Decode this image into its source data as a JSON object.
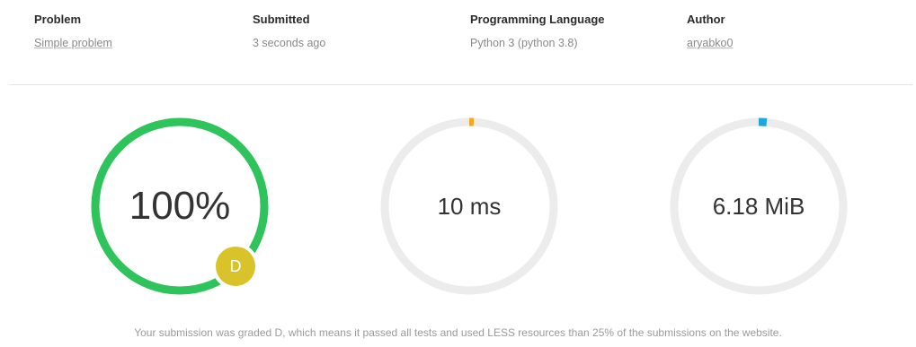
{
  "info": {
    "problem": {
      "label": "Problem",
      "value": "Simple problem"
    },
    "submitted": {
      "label": "Submitted",
      "value": "3 seconds ago"
    },
    "language": {
      "label": "Programming Language",
      "value": "Python 3 (python 3.8)"
    },
    "author": {
      "label": "Author",
      "value": "aryabko0"
    }
  },
  "gauges": {
    "score": {
      "value": "100%",
      "fraction": 1.0,
      "color": "#2ec35b"
    },
    "time": {
      "value": "10 ms",
      "fraction": 0.004,
      "color": "#f5a623"
    },
    "memory": {
      "value": "6.18 MiB",
      "fraction": 0.015,
      "color": "#1ea7dc"
    }
  },
  "grade": {
    "letter": "D",
    "color": "#d9c32a"
  },
  "colors": {
    "track": "#ececec"
  },
  "footnote": "Your submission was graded D, which means it passed all tests and used LESS resources than 25% of the submissions on the website."
}
